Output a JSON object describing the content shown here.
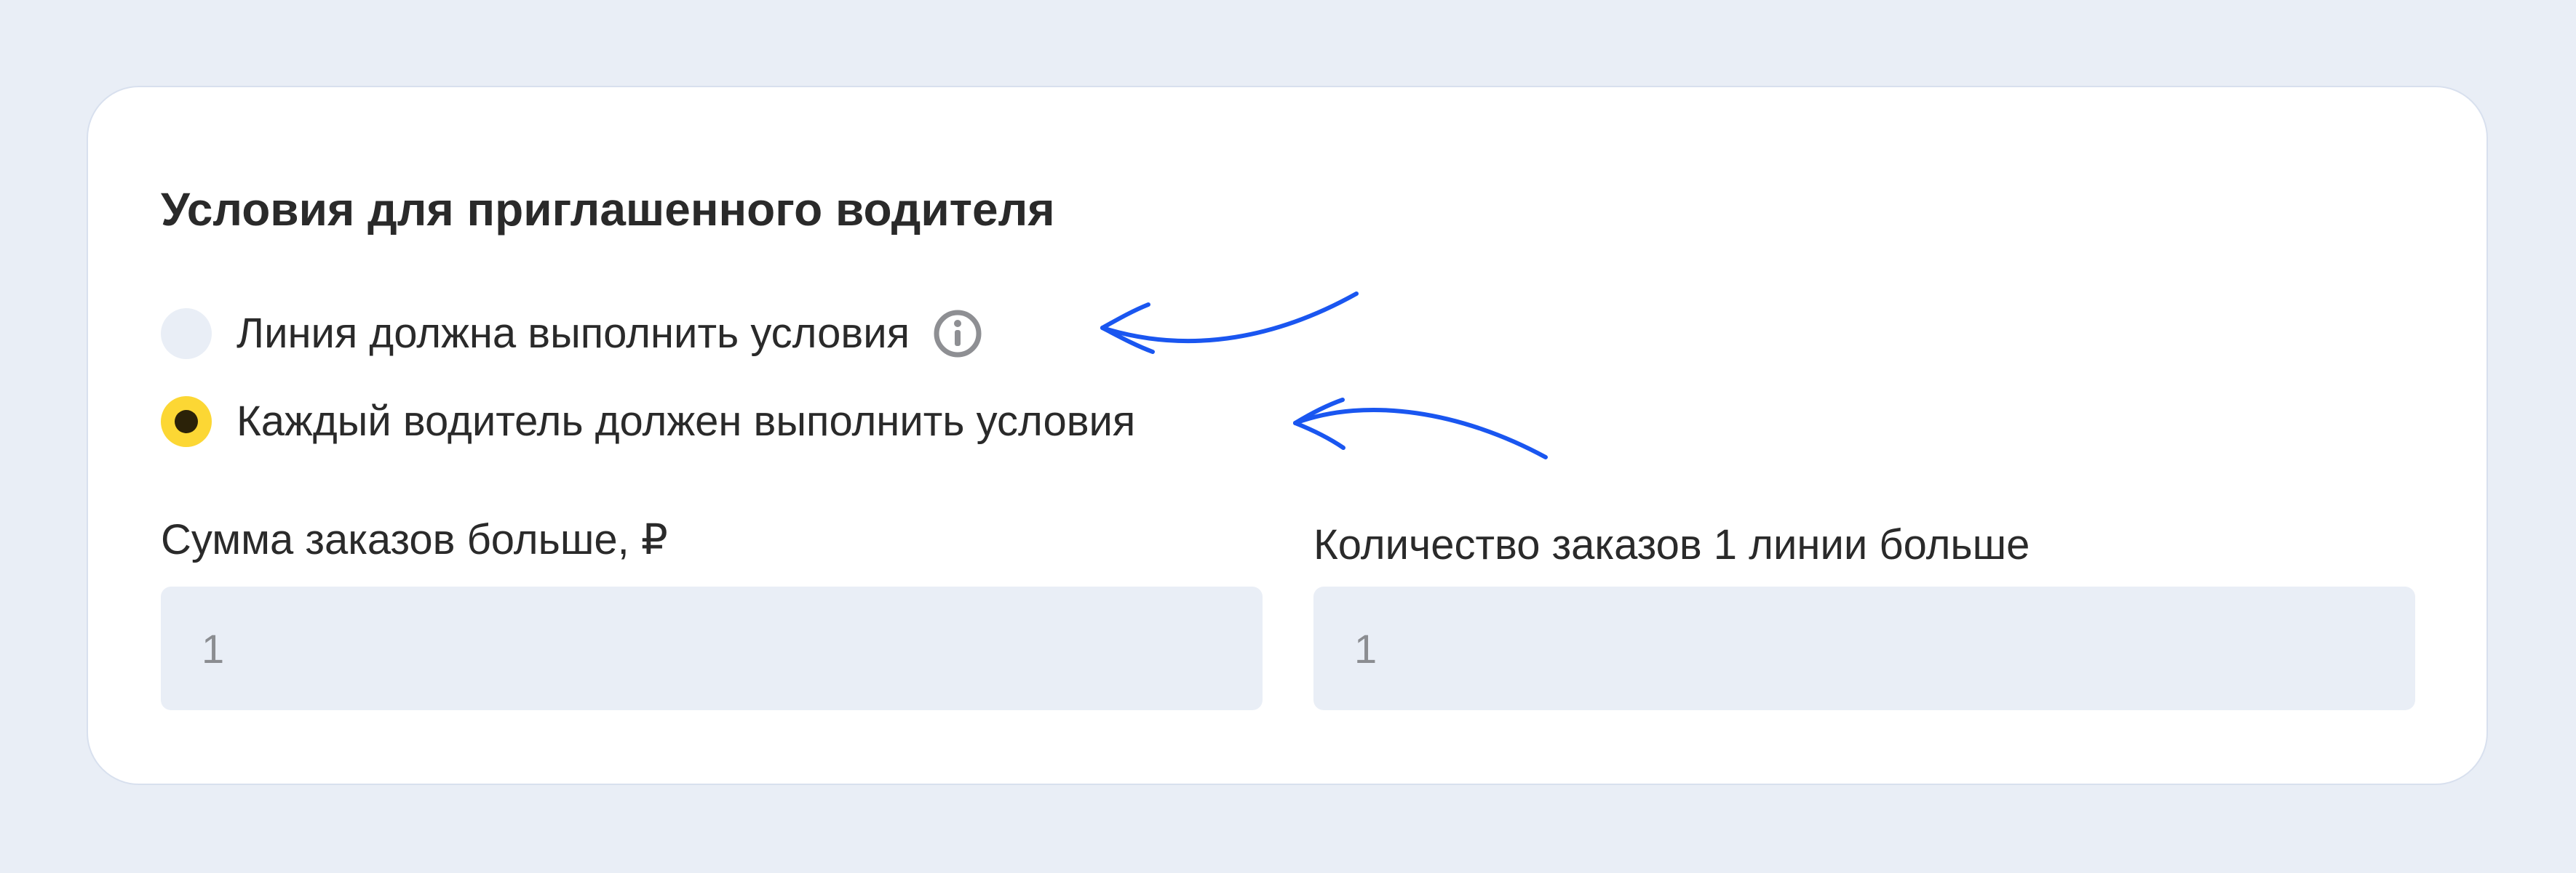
{
  "card": {
    "title": "Условия для приглашенного водителя"
  },
  "conditions": {
    "options": [
      {
        "label": "Линия должна выполнить условия",
        "selected": false,
        "has_info_icon": true,
        "info_icon": "info-icon"
      },
      {
        "label": "Каждый водитель должен выполнить условия",
        "selected": true
      }
    ]
  },
  "fields": {
    "orders_sum": {
      "label": "Сумма заказов больше, ₽",
      "value": "1"
    },
    "orders_count_line1": {
      "label": "Количество заказов 1 линии больше",
      "value": "1"
    }
  },
  "annotations": {
    "arrow_icon": "hand-drawn-arrow",
    "arrow_color": "#1a56f0"
  },
  "colors": {
    "background": "#e9eef6",
    "card": "#ffffff",
    "radio_selected": "#fcd734",
    "radio_dot": "#2b2208",
    "field_bg": "#e9eef6",
    "placeholder_text": "#8b8d91"
  }
}
